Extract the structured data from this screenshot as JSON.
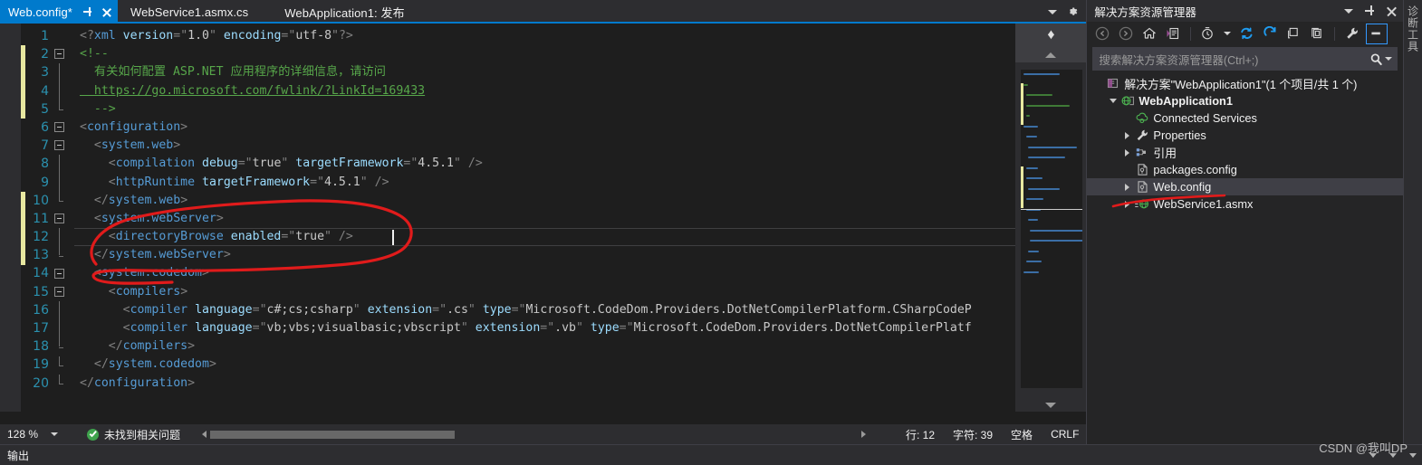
{
  "app": {
    "theme_bg": "#1e1e1e",
    "accent": "#007acc",
    "annotation_color": "#e01b1b"
  },
  "editor": {
    "tabs": [
      {
        "label": "Web.config*",
        "active": true,
        "dirty": true,
        "pin_icon": "pin-icon",
        "close_icon": "close-icon"
      },
      {
        "label": "WebService1.asmx.cs",
        "active": false
      },
      {
        "label": "WebApplication1: 发布",
        "active": false,
        "preview": true
      }
    ],
    "tabstrip_right": {
      "dropdown_icon": "chevron-down-icon",
      "settings_icon": "gear-icon"
    },
    "lines": [
      {
        "no": "1",
        "changed": false,
        "fold": "none",
        "html": "<span class='tk-punct'>&lt;?</span><span class='tk-decl'>xml</span> <span class='tk-attr'>version</span><span class='tk-punct'>=</span><span class='tk-q'>\"</span><span class='tk-val'>1.0</span><span class='tk-q'>\"</span> <span class='tk-attr'>encoding</span><span class='tk-punct'>=</span><span class='tk-q'>\"</span><span class='tk-val'>utf-8</span><span class='tk-q'>\"</span><span class='tk-punct'>?&gt;</span>"
      },
      {
        "no": "2",
        "changed": true,
        "fold": "open",
        "html": "<span class='tk-com'>&lt;!--</span>"
      },
      {
        "no": "3",
        "changed": true,
        "fold": "mid",
        "html": "<span class='tk-com'>  有关如何配置 ASP.NET 应用程序的详细信息，请访问</span>"
      },
      {
        "no": "4",
        "changed": true,
        "fold": "mid",
        "html": "<span class='tk-link'>  https://go.microsoft.com/fwlink/?LinkId=169433</span>"
      },
      {
        "no": "5",
        "changed": true,
        "fold": "close",
        "html": "<span class='tk-com'>  --&gt;</span>"
      },
      {
        "no": "6",
        "changed": false,
        "fold": "open",
        "html": "<span class='tk-punct'>&lt;</span><span class='tk-tag'>configuration</span><span class='tk-punct'>&gt;</span>"
      },
      {
        "no": "7",
        "changed": false,
        "fold": "open",
        "html": "  <span class='tk-punct'>&lt;</span><span class='tk-tag'>system.web</span><span class='tk-punct'>&gt;</span>"
      },
      {
        "no": "8",
        "changed": false,
        "fold": "mid",
        "html": "    <span class='tk-punct'>&lt;</span><span class='tk-tag'>compilation</span> <span class='tk-attr'>debug</span><span class='tk-punct'>=</span><span class='tk-q'>\"</span><span class='tk-val'>true</span><span class='tk-q'>\"</span> <span class='tk-attr'>targetFramework</span><span class='tk-punct'>=</span><span class='tk-q'>\"</span><span class='tk-val'>4.5.1</span><span class='tk-q'>\"</span> <span class='tk-punct'>/&gt;</span>"
      },
      {
        "no": "9",
        "changed": false,
        "fold": "mid",
        "html": "    <span class='tk-punct'>&lt;</span><span class='tk-tag'>httpRuntime</span> <span class='tk-attr'>targetFramework</span><span class='tk-punct'>=</span><span class='tk-q'>\"</span><span class='tk-val'>4.5.1</span><span class='tk-q'>\"</span> <span class='tk-punct'>/&gt;</span>"
      },
      {
        "no": "10",
        "changed": true,
        "fold": "close",
        "html": "  <span class='tk-punct'>&lt;/</span><span class='tk-tag'>system.web</span><span class='tk-punct'>&gt;</span>"
      },
      {
        "no": "11",
        "changed": true,
        "fold": "open",
        "html": "  <span class='tk-punct'>&lt;</span><span class='tk-tag'>system.webServer</span><span class='tk-punct'>&gt;</span>"
      },
      {
        "no": "12",
        "changed": true,
        "fold": "mid",
        "current": true,
        "html": "    <span class='tk-punct'>&lt;</span><span class='tk-tag'>directoryBrowse</span> <span class='tk-attr'>enabled</span><span class='tk-punct'>=</span><span class='tk-q'>\"</span><span class='tk-val'>true</span><span class='tk-q'>\"</span> <span class='tk-punct'>/&gt;</span>"
      },
      {
        "no": "13",
        "changed": true,
        "fold": "close",
        "html": "  <span class='tk-punct'>&lt;/</span><span class='tk-tag'>system.webServer</span><span class='tk-punct'>&gt;</span>"
      },
      {
        "no": "14",
        "changed": false,
        "fold": "open",
        "html": "  <span class='tk-punct'>&lt;</span><span class='tk-tag'>system.codedom</span><span class='tk-punct'>&gt;</span>"
      },
      {
        "no": "15",
        "changed": false,
        "fold": "open",
        "html": "    <span class='tk-punct'>&lt;</span><span class='tk-tag'>compilers</span><span class='tk-punct'>&gt;</span>"
      },
      {
        "no": "16",
        "changed": false,
        "fold": "mid",
        "html": "      <span class='tk-punct'>&lt;</span><span class='tk-tag'>compiler</span> <span class='tk-attr'>language</span><span class='tk-punct'>=</span><span class='tk-q'>\"</span><span class='tk-val'>c#;cs;csharp</span><span class='tk-q'>\"</span> <span class='tk-attr'>extension</span><span class='tk-punct'>=</span><span class='tk-q'>\"</span><span class='tk-val'>.cs</span><span class='tk-q'>\"</span> <span class='tk-attr'>type</span><span class='tk-punct'>=</span><span class='tk-q'>\"</span><span class='tk-val'>Microsoft.CodeDom.Providers.DotNetCompilerPlatform.CSharpCodeP</span>"
      },
      {
        "no": "17",
        "changed": false,
        "fold": "mid",
        "html": "      <span class='tk-punct'>&lt;</span><span class='tk-tag'>compiler</span> <span class='tk-attr'>language</span><span class='tk-punct'>=</span><span class='tk-q'>\"</span><span class='tk-val'>vb;vbs;visualbasic;vbscript</span><span class='tk-q'>\"</span> <span class='tk-attr'>extension</span><span class='tk-punct'>=</span><span class='tk-q'>\"</span><span class='tk-val'>.vb</span><span class='tk-q'>\"</span> <span class='tk-attr'>type</span><span class='tk-punct'>=</span><span class='tk-q'>\"</span><span class='tk-val'>Microsoft.CodeDom.Providers.DotNetCompilerPlatf</span>"
      },
      {
        "no": "18",
        "changed": false,
        "fold": "close",
        "html": "    <span class='tk-punct'>&lt;/</span><span class='tk-tag'>compilers</span><span class='tk-punct'>&gt;</span>"
      },
      {
        "no": "19",
        "changed": false,
        "fold": "close",
        "html": "  <span class='tk-punct'>&lt;/</span><span class='tk-tag'>system.codedom</span><span class='tk-punct'>&gt;</span>"
      },
      {
        "no": "20",
        "changed": false,
        "fold": "close",
        "html": "<span class='tk-punct'>&lt;/</span><span class='tk-tag'>configuration</span><span class='tk-punct'>&gt;</span>"
      }
    ],
    "minimap": {
      "splitter_icon": "split-view-icon",
      "scroll_up_icon": "triangle-up-icon",
      "scroll_down_icon": "triangle-down-icon"
    }
  },
  "statusbar": {
    "zoom": "128 %",
    "zoom_chevron_icon": "chevron-down-icon",
    "issue_icon": "check-circle-icon",
    "issue_text": "未找到相关问题",
    "line_label": "行: 12",
    "char_label": "字符: 39",
    "spaces_label": "空格",
    "eol_label": "CRLF"
  },
  "bottom_panel": {
    "label": "输出"
  },
  "solution_explorer": {
    "title": "解决方案资源管理器",
    "header_buttons": {
      "dropdown_icon": "chevron-down-icon",
      "pin_icon": "pin-icon",
      "close_icon": "close-icon"
    },
    "toolbar": [
      {
        "name": "back-icon"
      },
      {
        "name": "forward-icon"
      },
      {
        "name": "home-icon"
      },
      {
        "name": "solution-explorer-icon"
      },
      {
        "name": "pending-changes-icon"
      },
      {
        "name": "sync-icon"
      },
      {
        "name": "refresh-icon"
      },
      {
        "name": "collapse-all-icon"
      },
      {
        "name": "show-all-files-icon"
      },
      {
        "name": "properties-wrench-icon"
      },
      {
        "name": "preview-selected-items-icon"
      }
    ],
    "search_placeholder": "搜索解决方案资源管理器(Ctrl+;)",
    "search_value": "",
    "search_icon": "magnifier-icon",
    "search_dropdown_icon": "chevron-down-icon",
    "tree": [
      {
        "label": "解决方案\"WebApplication1\"(1 个项目/共 1 个)",
        "indent": 0,
        "twist": "none",
        "icon": "solution-icon",
        "bold": false,
        "selected": false
      },
      {
        "label": "WebApplication1",
        "indent": 1,
        "twist": "down",
        "icon": "web-project-icon",
        "bold": true,
        "selected": false
      },
      {
        "label": "Connected Services",
        "indent": 2,
        "twist": "none",
        "icon": "connected-services-icon",
        "bold": false,
        "selected": false
      },
      {
        "label": "Properties",
        "indent": 2,
        "twist": "right",
        "icon": "wrench-icon",
        "bold": false,
        "selected": false
      },
      {
        "label": "引用",
        "indent": 2,
        "twist": "right",
        "icon": "references-icon",
        "bold": false,
        "selected": false
      },
      {
        "label": "packages.config",
        "indent": 2,
        "twist": "none",
        "icon": "config-file-icon",
        "bold": false,
        "selected": false
      },
      {
        "label": "Web.config",
        "indent": 2,
        "twist": "right",
        "icon": "config-file-icon",
        "bold": false,
        "selected": true
      },
      {
        "label": "WebService1.asmx",
        "indent": 2,
        "twist": "right",
        "icon": "asmx-file-icon",
        "bold": false,
        "selected": false
      }
    ]
  },
  "right_dock": {
    "label": "诊断工具"
  },
  "watermark": {
    "text": "CSDN @我叫DP"
  }
}
